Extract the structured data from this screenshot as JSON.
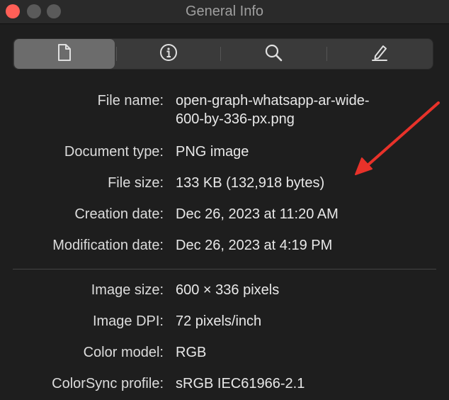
{
  "window": {
    "title": "General Info"
  },
  "toolbar": {
    "tabs": [
      {
        "name": "document-tab",
        "icon": "document-icon",
        "selected": true
      },
      {
        "name": "info-tab",
        "icon": "info-icon",
        "selected": false
      },
      {
        "name": "search-tab",
        "icon": "magnifier-icon",
        "selected": false
      },
      {
        "name": "edit-tab",
        "icon": "pencil-icon",
        "selected": false
      }
    ]
  },
  "general": [
    {
      "label": "File name:",
      "value": "open-graph-whatsapp-ar-wide-600-by-336-px.png"
    },
    {
      "label": "Document type:",
      "value": "PNG image"
    },
    {
      "label": "File size:",
      "value": "133 KB (132,918 bytes)"
    },
    {
      "label": "Creation date:",
      "value": "Dec 26, 2023 at 11:20 AM"
    },
    {
      "label": "Modification date:",
      "value": "Dec 26, 2023 at 4:19 PM"
    }
  ],
  "image": [
    {
      "label": "Image size:",
      "value": "600 × 336 pixels"
    },
    {
      "label": "Image DPI:",
      "value": "72 pixels/inch"
    },
    {
      "label": "Color model:",
      "value": "RGB"
    },
    {
      "label": "ColorSync profile:",
      "value": "sRGB IEC61966-2.1"
    }
  ],
  "annotation": {
    "arrow_color": "#e8322a"
  }
}
